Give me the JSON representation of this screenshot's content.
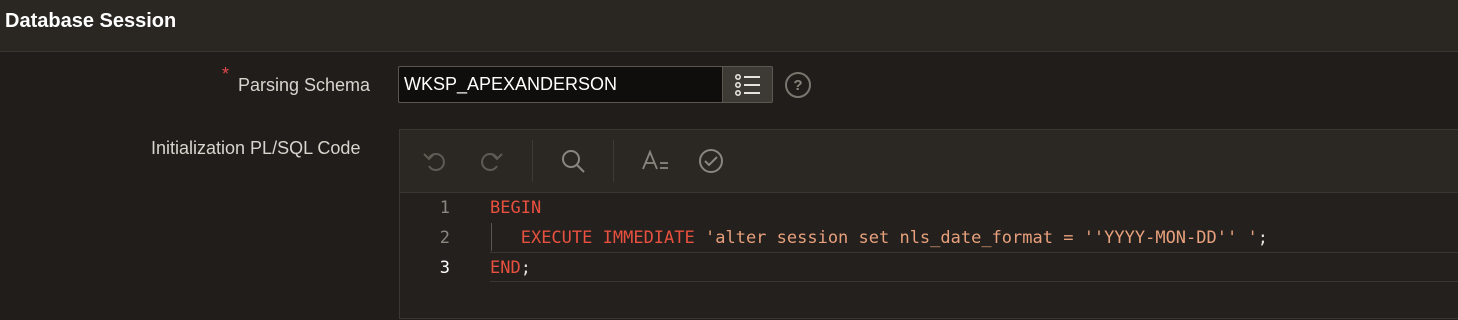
{
  "header": {
    "title": "Database Session"
  },
  "parsing_schema": {
    "required_marker": "*",
    "label": "Parsing Schema",
    "value": "WKSP_APEXANDERSON",
    "help_glyph": "?"
  },
  "init_code": {
    "label": "Initialization PL/SQL Code",
    "toolbar": [
      "undo-icon",
      "redo-icon",
      "search-icon",
      "text-format-icon",
      "validate-icon"
    ],
    "lines": [
      {
        "number": "1",
        "kw1": "BEGIN"
      },
      {
        "number": "2",
        "kw1": "EXECUTE",
        "kw2": "IMMEDIATE",
        "str": "'alter session set nls_date_format = ''YYYY-MON-DD'' '",
        "punc": ";"
      },
      {
        "number": "3",
        "kw1": "END",
        "punc": ";"
      }
    ]
  },
  "colors": {
    "keyword": "#e8503f",
    "string": "#e8a07c",
    "background": "#201d1a"
  }
}
